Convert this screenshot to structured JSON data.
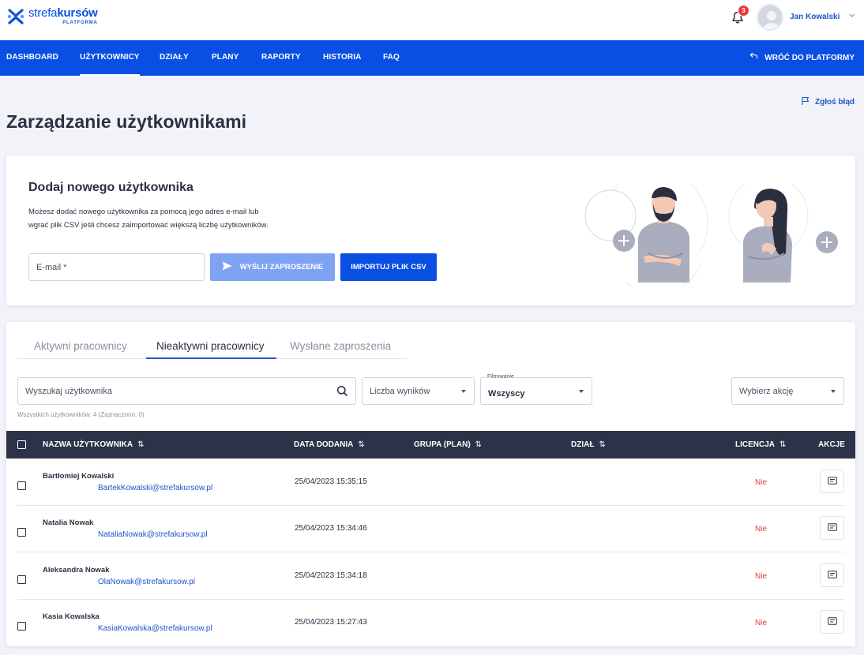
{
  "header": {
    "logo": {
      "word_thin": "strefa",
      "word_bold": "kursów",
      "sub": "PLATFORMA"
    },
    "notifications_count": "3",
    "user_name": "Jan Kowalski"
  },
  "nav": {
    "items": [
      "DASHBOARD",
      "UŻYTKOWNICY",
      "DZIAŁY",
      "PLANY",
      "RAPORTY",
      "HISTORIA",
      "FAQ"
    ],
    "active": "UŻYTKOWNICY",
    "back_label": "WRÓĆ DO PLATFORMY"
  },
  "page": {
    "report_label": "Zgłoś błąd",
    "title": "Zarządzanie użytkownikami"
  },
  "add_user": {
    "title": "Dodaj nowego użytkownika",
    "description_line1": "Możesz dodać nowego użytkownika za pomocą jego adres e-mail lub",
    "description_line2": "wgrać plik CSV jeśli chcesz zaimportować większą liczbę użytkowników.",
    "email_placeholder": "E-mail *",
    "send_label": "WYŚLIJ ZAPROSZENIE",
    "import_label": "IMPORTUJ PLIK CSV"
  },
  "users": {
    "tabs": [
      "Aktywni pracownicy",
      "Nieaktywni pracownicy",
      "Wysłane zaproszenia"
    ],
    "active_tab": "Nieaktywni pracownicy",
    "search_placeholder": "Wyszukaj użytkownika",
    "results_count_placeholder": "Liczba wyników",
    "filter_label": "Filtrowanie",
    "filter_value": "Wszyscy",
    "action_placeholder": "Wybierz akcję",
    "count_info": "Wszystkich użytkowników: 4 (Zaznaczono: 0)",
    "columns": {
      "name": "NAZWA UŻYTKOWNIKA",
      "date": "DATA DODANIA",
      "group": "GRUPA (PLAN)",
      "department": "DZIAŁ",
      "license": "LICENCJA",
      "actions": "AKCJE"
    },
    "rows": [
      {
        "name": "Bartłomiej Kowalski",
        "email": "BartekKowalski@strefakursow.pl",
        "date": "25/04/2023 15:35:15",
        "license": "Nie"
      },
      {
        "name": "Natalia Nowak",
        "email": "NataliaNowak@strefakursow.pl",
        "date": "25/04/2023 15:34:46",
        "license": "Nie"
      },
      {
        "name": "Aleksandra Nowak",
        "email": "OlaNowak@strefakursow.pl",
        "date": "25/04/2023 15:34:18",
        "license": "Nie"
      },
      {
        "name": "Kasia Kowalska",
        "email": "KasiaKowalska@strefakursow.pl",
        "date": "25/04/2023 15:27:43",
        "license": "Nie"
      }
    ]
  },
  "colors": {
    "brand_blue": "#0a4fe4",
    "link_blue": "#1f55c7",
    "table_header": "#2c3349",
    "danger": "#e23a3a"
  }
}
